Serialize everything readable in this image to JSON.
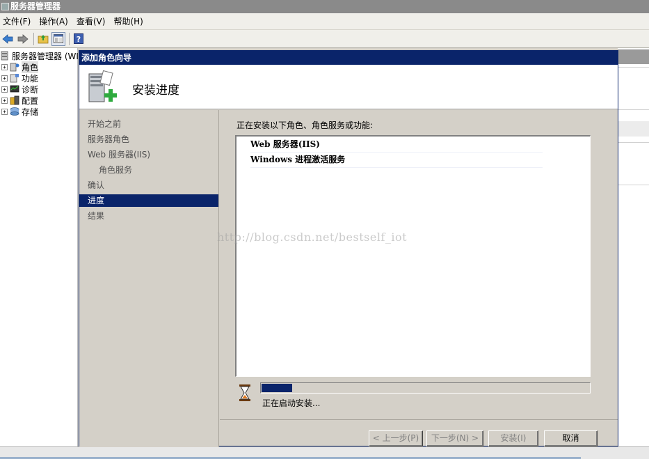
{
  "window": {
    "title": "服务器管理器"
  },
  "menu": {
    "items": [
      "文件(F)",
      "操作(A)",
      "查看(V)",
      "帮助(H)"
    ]
  },
  "toolbar": {
    "icons": [
      "back-arrow-icon",
      "forward-arrow-icon",
      "up-folder-icon",
      "show-hide-console-tree-icon",
      "help-icon"
    ]
  },
  "tree": {
    "root": "服务器管理器 (WIN",
    "items": [
      "角色",
      "功能",
      "诊断",
      "配置",
      "存储"
    ]
  },
  "wizard": {
    "title": "添加角色向导",
    "header": "安装进度",
    "nav": {
      "items": [
        {
          "label": "开始之前",
          "sub": false,
          "active": false
        },
        {
          "label": "服务器角色",
          "sub": false,
          "active": false
        },
        {
          "label": "Web 服务器(IIS)",
          "sub": false,
          "active": false
        },
        {
          "label": "角色服务",
          "sub": true,
          "active": false
        },
        {
          "label": "确认",
          "sub": false,
          "active": false
        },
        {
          "label": "进度",
          "sub": false,
          "active": true
        },
        {
          "label": "结果",
          "sub": false,
          "active": false
        }
      ]
    },
    "content": {
      "label": "正在安装以下角色、角色服务或功能:",
      "items": [
        "Web 服务器(IIS)",
        "Windows 进程激活服务"
      ],
      "progress_fraction": 0.093,
      "status": "正在启动安装..."
    },
    "buttons": {
      "prev": "< 上一步(P)",
      "next": "下一步(N) >",
      "install": "安装(I)",
      "cancel": "取消"
    }
  },
  "watermark": "http://blog.csdn.net/bestself_iot",
  "colors": {
    "accent": "#0a246a",
    "dialog_bg": "#d4d0c8"
  }
}
